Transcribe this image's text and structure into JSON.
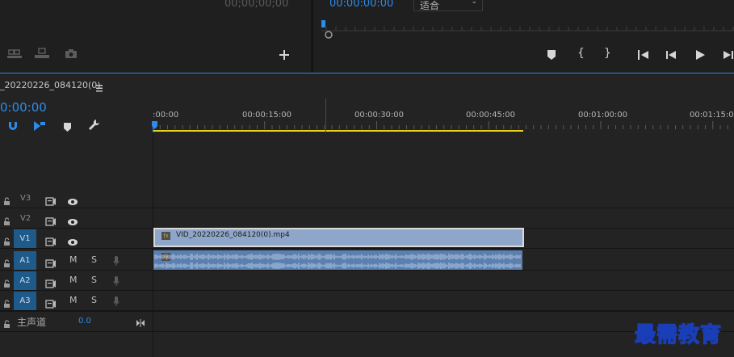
{
  "source_monitor": {
    "timecode": "00;00;00;00",
    "icons": [
      "insert-icon",
      "overwrite-icon",
      "camera-icon"
    ],
    "add_icon": "plus-icon"
  },
  "program_monitor": {
    "timecode": "00:00:00:00",
    "zoom": "适合",
    "transport_icons": [
      "marker-icon",
      "mark-in-icon",
      "mark-out-icon",
      "go-to-in-icon",
      "step-back-icon",
      "play-icon",
      "step-forward-icon"
    ]
  },
  "timeline": {
    "sequence_name": "_20220226_084120(0)",
    "timecode": "0:00:00",
    "ruler_labels": [
      ":00:00",
      "00:00:15:00",
      "00:00:30:00",
      "00:00:45:00",
      "00:01:00:00",
      "00:01:15:00"
    ],
    "tracks": [
      {
        "id": "V3",
        "type": "video",
        "targeted": false
      },
      {
        "id": "V2",
        "type": "video",
        "targeted": false
      },
      {
        "id": "V1",
        "type": "video",
        "targeted": true
      },
      {
        "id": "A1",
        "type": "audio",
        "targeted": true
      },
      {
        "id": "A2",
        "type": "audio",
        "targeted": true
      },
      {
        "id": "A3",
        "type": "audio",
        "targeted": true
      }
    ],
    "mute_label": "M",
    "solo_label": "S",
    "master": {
      "label": "主声道",
      "value": "0.0"
    },
    "clip": {
      "name": "VID_20220226_084120(0).mp4",
      "fx": "fx"
    }
  },
  "watermark": "最需教育",
  "colors": {
    "accent": "#2d8ceb",
    "clip_video": "#8ea6c9",
    "clip_audio": "#5b7fae",
    "work_area": "#e6d21c"
  }
}
